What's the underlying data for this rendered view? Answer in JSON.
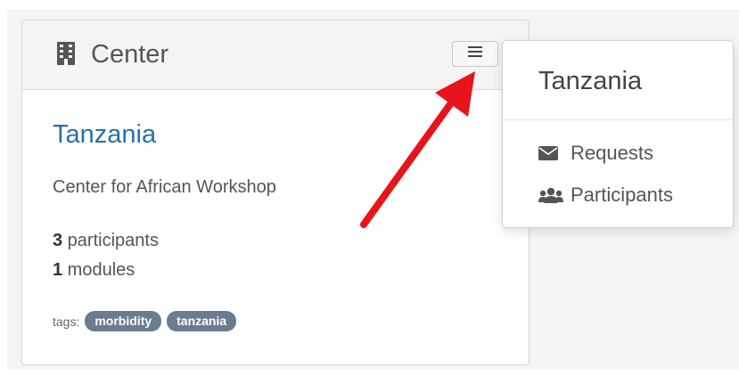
{
  "card": {
    "title": "Center",
    "name": "Tanzania",
    "description": "Center for African Workshop",
    "participants_count": "3",
    "participants_label": " participants",
    "modules_count": "1",
    "modules_label": " modules",
    "tags_label": "tags:",
    "tags": [
      "morbidity",
      "tanzania"
    ]
  },
  "dropdown": {
    "header": "Tanzania",
    "items": [
      {
        "label": "Requests",
        "icon": "envelope-icon"
      },
      {
        "label": "Participants",
        "icon": "users-icon"
      }
    ]
  },
  "colors": {
    "link": "#2a6fa8",
    "tag": "#6a7d8e",
    "annotation_arrow": "#e8141b"
  }
}
